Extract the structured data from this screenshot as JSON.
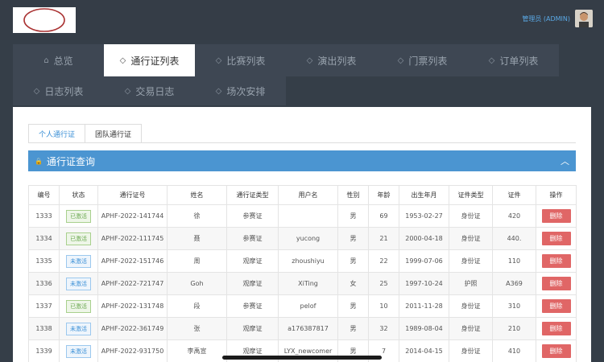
{
  "header": {
    "admin_name": "管理员 (ADMIN)"
  },
  "nav": {
    "row1": [
      {
        "label": "总览",
        "icon": "home-icon",
        "active": false
      },
      {
        "label": "通行证列表",
        "icon": "tag-icon",
        "active": true
      },
      {
        "label": "比赛列表",
        "icon": "tag-icon",
        "active": false
      },
      {
        "label": "演出列表",
        "icon": "tag-icon",
        "active": false
      },
      {
        "label": "门票列表",
        "icon": "tag-icon",
        "active": false
      },
      {
        "label": "订单列表",
        "icon": "tag-icon",
        "active": false
      }
    ],
    "row2": [
      {
        "label": "日志列表",
        "icon": "tag-icon"
      },
      {
        "label": "交易日志",
        "icon": "tag-icon"
      },
      {
        "label": "场次安排",
        "icon": "tag-icon"
      }
    ]
  },
  "tabs": [
    "个人通行证",
    "团队通行证"
  ],
  "panel": {
    "title": "通行证查询",
    "accent": "#4b95d1"
  },
  "table": {
    "headers": [
      "编号",
      "状态",
      "通行证号",
      "姓名",
      "通行证类型",
      "用户名",
      "性别",
      "年龄",
      "出生年月",
      "证件类型",
      "证件",
      "操作"
    ],
    "delete_label": "删除",
    "rows": [
      {
        "id": "1333",
        "status": "已激活",
        "active": true,
        "pass_no": "APHF-2022-141744",
        "name": "徐",
        "pass_type": "参赛证",
        "username": "",
        "gender": "男",
        "age": "69",
        "birth": "1953-02-27",
        "doc_type": "身份证",
        "doc": "420"
      },
      {
        "id": "1334",
        "status": "已激活",
        "active": true,
        "pass_no": "APHF-2022-111745",
        "name": "聂",
        "pass_type": "参赛证",
        "username": "yucong",
        "gender": "男",
        "age": "21",
        "birth": "2000-04-18",
        "doc_type": "身份证",
        "doc": "440."
      },
      {
        "id": "1335",
        "status": "未激活",
        "active": false,
        "pass_no": "APHF-2022-151746",
        "name": "周",
        "pass_type": "观摩证",
        "username": "zhoushiyu",
        "gender": "男",
        "age": "22",
        "birth": "1999-07-06",
        "doc_type": "身份证",
        "doc": "110"
      },
      {
        "id": "1336",
        "status": "未激活",
        "active": false,
        "pass_no": "APHF-2022-721747",
        "name": "Goh",
        "pass_type": "观摩证",
        "username": "XiTing",
        "gender": "女",
        "age": "25",
        "birth": "1997-10-24",
        "doc_type": "护照",
        "doc": "A369"
      },
      {
        "id": "1337",
        "status": "已激活",
        "active": true,
        "pass_no": "APHF-2022-131748",
        "name": "段",
        "pass_type": "参赛证",
        "username": "pelof",
        "gender": "男",
        "age": "10",
        "birth": "2011-11-28",
        "doc_type": "身份证",
        "doc": "310"
      },
      {
        "id": "1338",
        "status": "未激活",
        "active": false,
        "pass_no": "APHF-2022-361749",
        "name": "张",
        "pass_type": "观摩证",
        "username": "a176387817",
        "gender": "男",
        "age": "32",
        "birth": "1989-08-04",
        "doc_type": "身份证",
        "doc": "210"
      },
      {
        "id": "1339",
        "status": "未激活",
        "active": false,
        "pass_no": "APHF-2022-931750",
        "name": "李禹宣",
        "pass_type": "观摩证",
        "username": "LYX_newcomer",
        "gender": "男",
        "age": "7",
        "birth": "2014-04-15",
        "doc_type": "身份证",
        "doc": "410"
      }
    ]
  }
}
